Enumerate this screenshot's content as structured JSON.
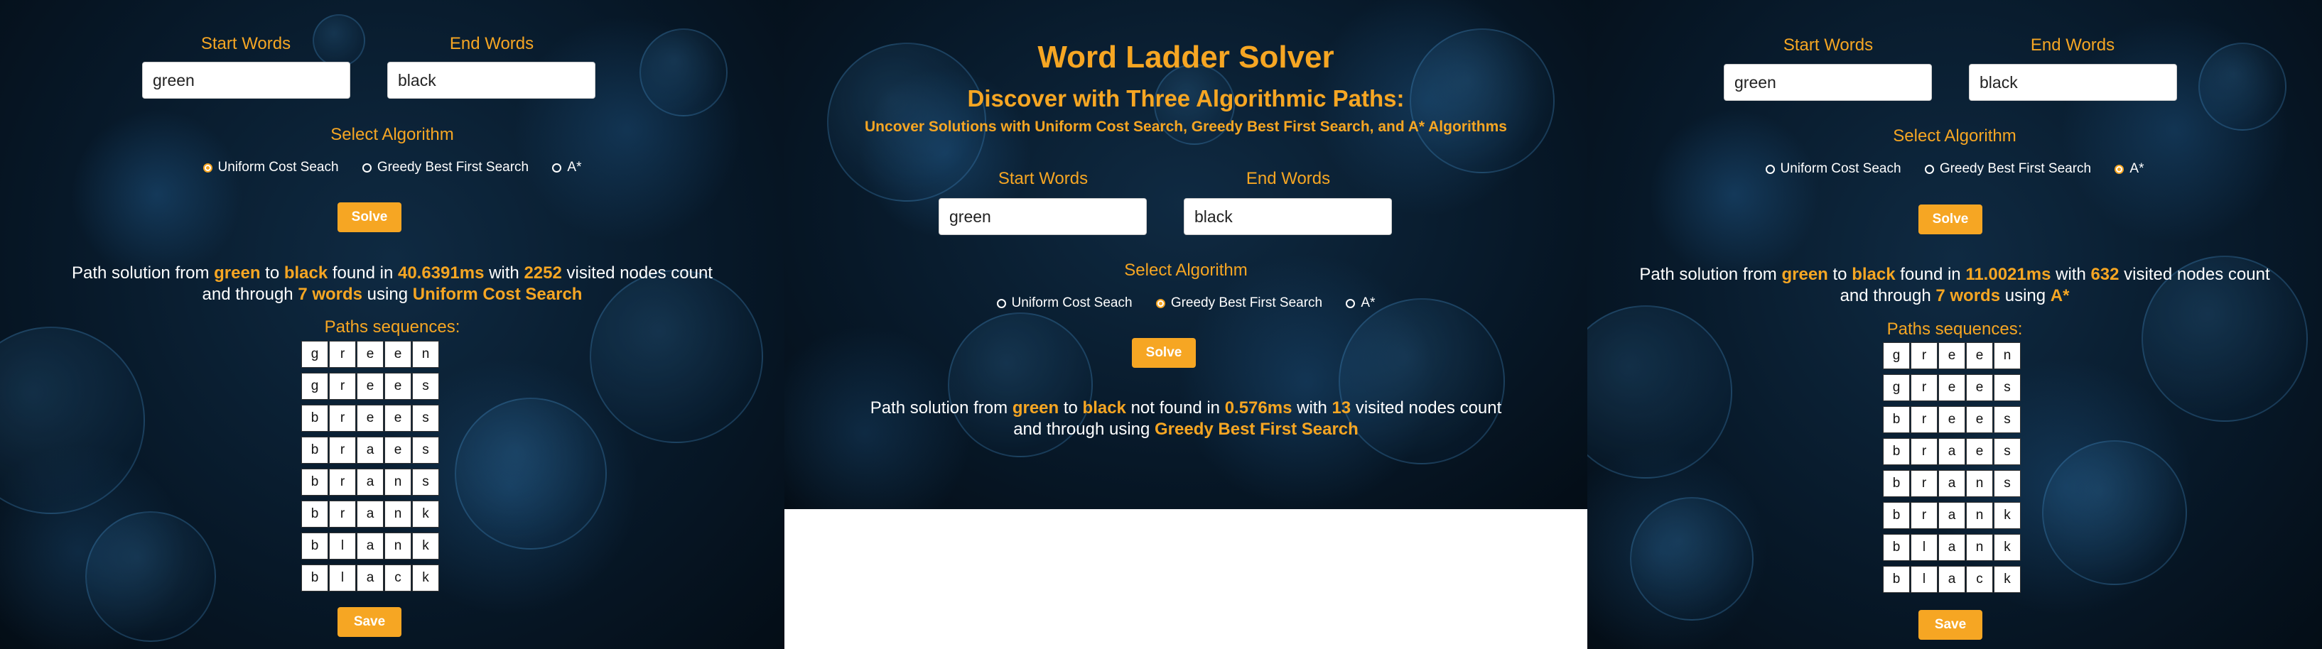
{
  "common": {
    "start_label": "Start Words",
    "end_label": "End Words",
    "select_label": "Select Algorithm",
    "solve_label": "Solve",
    "save_label": "Save",
    "paths_label": "Paths sequences:",
    "algorithms": [
      "Uniform Cost Seach",
      "Greedy Best First Search",
      "A*"
    ]
  },
  "center": {
    "title": "Word Ladder Solver",
    "subtitle": "Discover with Three Algorithmic Paths:",
    "tagline": "Uncover Solutions with Uniform Cost Search, Greedy Best First Search, and A* Algorithms",
    "start_value": "green",
    "end_value": "black",
    "selected": "Greedy Best First Search",
    "result": {
      "p1": "Path solution from ",
      "start": "green",
      "p2": " to ",
      "end": "black",
      "p3": " not found in ",
      "time": "0.576ms",
      "p4": " with ",
      "visited": "13",
      "p5": " visited nodes count",
      "p6": "and through using ",
      "algo": "Greedy Best First Search"
    }
  },
  "left": {
    "start_value": "green",
    "end_value": "black",
    "selected": "Uniform Cost Seach",
    "result": {
      "p1": "Path solution from ",
      "start": "green",
      "p2": " to ",
      "end": "black",
      "p3": " found in ",
      "time": "40.6391ms",
      "p4": " with ",
      "visited": "2252",
      "p5": " visited nodes count",
      "p6": "and through ",
      "words": "7 words",
      "p7": " using ",
      "algo": "Uniform Cost Search"
    },
    "paths": [
      "green",
      "grees",
      "brees",
      "braes",
      "brans",
      "brank",
      "blank",
      "black"
    ]
  },
  "right": {
    "start_value": "green",
    "end_value": "black",
    "selected": "A*",
    "result": {
      "p1": "Path solution from ",
      "start": "green",
      "p2": " to ",
      "end": "black",
      "p3": " found in ",
      "time": "11.0021ms",
      "p4": " with ",
      "visited": "632",
      "p5": " visited nodes count",
      "p6": "and through ",
      "words": "7 words",
      "p7": " using ",
      "algo": "A*"
    },
    "paths": [
      "green",
      "grees",
      "brees",
      "braes",
      "brans",
      "brank",
      "blank",
      "black"
    ]
  }
}
